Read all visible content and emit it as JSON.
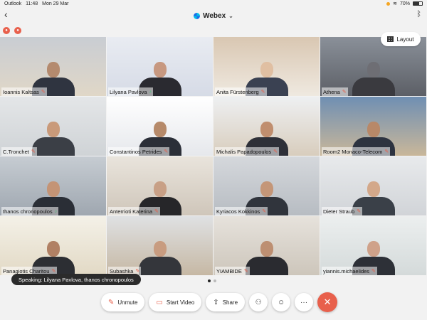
{
  "status": {
    "app": "Outlook",
    "time": "11:48",
    "date": "Mon 29 Mar",
    "battery": "70%",
    "battery_level": 0.7
  },
  "header": {
    "title": "Webex"
  },
  "layout_button": {
    "label": "Layout"
  },
  "participants": [
    {
      "name": "Ioannis Kaltsas",
      "muted": true
    },
    {
      "name": "Lilyana Pavlova",
      "muted": false,
      "active": true
    },
    {
      "name": "Anita Fürstenberg",
      "muted": true
    },
    {
      "name": "Athena",
      "muted": true
    },
    {
      "name": "C.Tronchet",
      "muted": true
    },
    {
      "name": "Constantinos Petrides",
      "muted": true
    },
    {
      "name": "Michalis Papadopoulos",
      "muted": true
    },
    {
      "name": "Room2 Monaco-Telecom",
      "muted": true
    },
    {
      "name": "thanos chronopoulos",
      "muted": false
    },
    {
      "name": "Anterrioti Katerina",
      "muted": true
    },
    {
      "name": "Kyriacos Kokkinos",
      "muted": true
    },
    {
      "name": "Dieter Straub",
      "muted": true
    },
    {
      "name": "Panagiotis Charitou",
      "muted": true
    },
    {
      "name": "Subashka",
      "muted": true
    },
    {
      "name": "YIAMBIDE",
      "muted": true
    },
    {
      "name": "yiannis.michaelides",
      "muted": true
    }
  ],
  "speaking_banner": "Speaking: Lilyana Pavlova, thanos chronopoulos",
  "controls": {
    "unmute": "Unmute",
    "start_video": "Start Video",
    "share": "Share"
  },
  "colors": {
    "accent": "#e8604c",
    "active_speaker": "#49c27a",
    "webex_blue": "#1e6be6"
  }
}
